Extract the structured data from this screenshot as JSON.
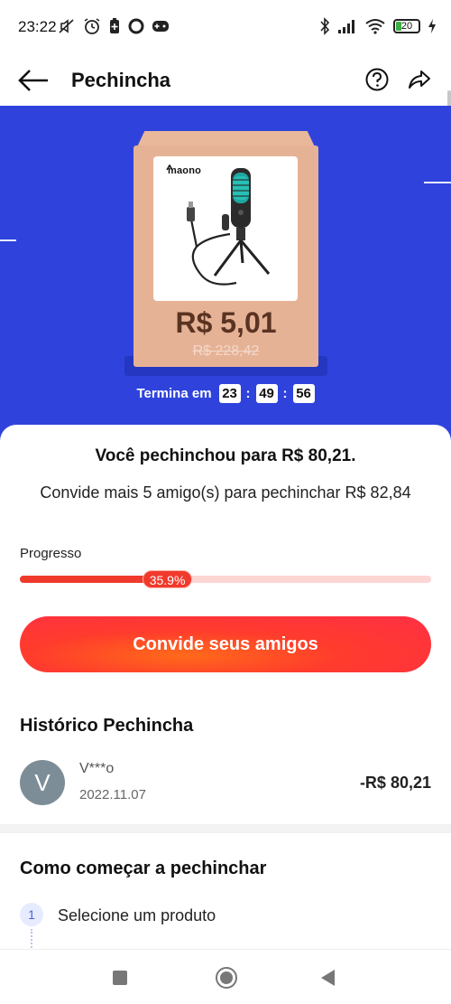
{
  "status_bar": {
    "time": "23:22",
    "battery_level": "20",
    "left_icons": [
      "mute-icon",
      "alarm-icon",
      "battery-saver-icon",
      "circle-app-icon",
      "gamepad-icon"
    ],
    "right_icons": [
      "bluetooth-icon",
      "signal-icon",
      "wifi-icon",
      "battery-icon",
      "charging-icon"
    ]
  },
  "app_bar": {
    "title": "Pechincha",
    "icons": [
      "back-arrow-icon",
      "help-icon",
      "share-icon"
    ]
  },
  "hero": {
    "background_color": "#2f43dc",
    "product": {
      "brand": "maono",
      "price_now": "R$ 5,01",
      "price_original": "R$ 228,42"
    },
    "timer": {
      "label": "Termina em",
      "hours": "23",
      "minutes": "49",
      "seconds": "56",
      "separator": ":"
    }
  },
  "bargain": {
    "headline": "Você pechinchou para R$ 80,21.",
    "subline": "Convide mais 5 amigo(s) para pechinchar R$ 82,84",
    "progress_label": "Progresso",
    "progress_percent": 35.9,
    "progress_text": "35.9%",
    "cta_label": "Convide seus amigos",
    "accent_color": "#f03a2c"
  },
  "history": {
    "title": "Histórico Pechincha",
    "entries": [
      {
        "avatar_letter": "V",
        "name": "V***o",
        "date": "2022.11.07",
        "amount": "-R$ 80,21"
      }
    ]
  },
  "how_to": {
    "title": "Como começar a pechinchar",
    "steps": [
      {
        "number": "1",
        "label": "Selecione um produto"
      }
    ]
  },
  "nav_bar": {
    "buttons": [
      "recents-button",
      "home-button",
      "back-button"
    ]
  }
}
